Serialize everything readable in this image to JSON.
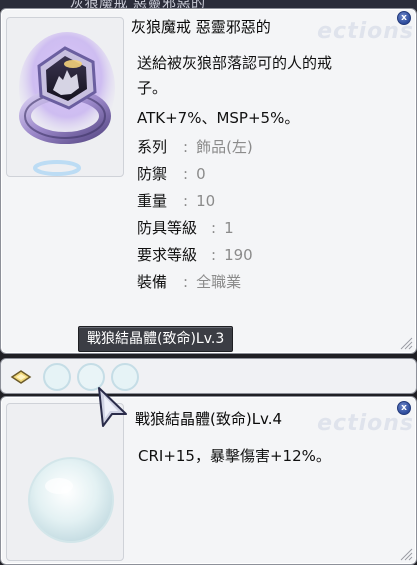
{
  "background_strip": {
    "ghost_text": "灰狼魔戒 惡靈邪惡的"
  },
  "item_window_1": {
    "watermark": "ections",
    "close_glyph": "x",
    "title": "灰狼魔戒 惡靈邪惡的",
    "description_lines": [
      "送給被灰狼部落認可的人的戒",
      "子。",
      "ATK+7%、MSP+5%。"
    ],
    "attributes": [
      {
        "label": "系列",
        "value": "飾品(左)"
      },
      {
        "label": "防禦",
        "value": "0"
      },
      {
        "label": "重量",
        "value": "10"
      },
      {
        "label": "防具等級",
        "value": "1"
      },
      {
        "label": "要求等級",
        "value": "190"
      },
      {
        "label": "裝備",
        "value": "全職業"
      }
    ],
    "attribute_colon": ":",
    "card_slot_label": "戰狼結晶體(致命)Lv.3",
    "image_icon": "gray-wolf-ring-icon"
  },
  "slot_strip": {
    "icons": [
      "card-slot-icon",
      "crystal-slot-icon"
    ]
  },
  "item_window_2": {
    "watermark": "ections",
    "close_glyph": "x",
    "title": "戰狼結晶體(致命)Lv.4",
    "description_lines": [
      "CRI+15，暴擊傷害+12%。"
    ],
    "image_icon": "crystal-orb-icon"
  },
  "colors": {
    "window_bg": "#f4f5f7",
    "window_border": "#8d9099",
    "value_gray": "#8b8b8b",
    "close_button_blue": "#2c4b9c",
    "slot_label_bg": "#3b3d44"
  }
}
